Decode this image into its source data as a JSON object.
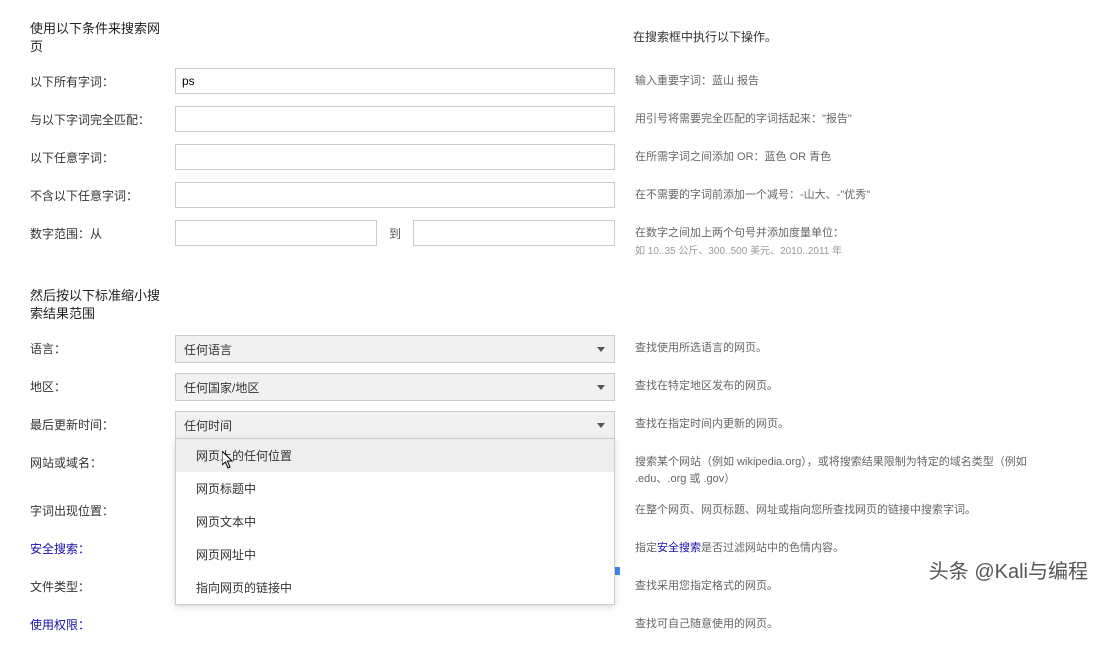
{
  "section1": {
    "title": "使用以下条件来搜索网页",
    "right_title": "在搜索框中执行以下操作。",
    "rows": [
      {
        "label": "以下所有字词：",
        "value": "ps",
        "help": "输入重要字词：蓝山 报告"
      },
      {
        "label": "与以下字词完全匹配：",
        "value": "",
        "help": "用引号将需要完全匹配的字词括起来：\"报告\""
      },
      {
        "label": "以下任意字词：",
        "value": "",
        "help": "在所需字词之间添加 OR：蓝色 OR 青色"
      },
      {
        "label": "不含以下任意字词：",
        "value": "",
        "help": "在不需要的字词前添加一个减号：-山大、-\"优秀\""
      }
    ],
    "range": {
      "label": "数字范围：从",
      "from": "",
      "sep": "到",
      "to": "",
      "help": "在数字之间加上两个句号并添加度量单位：",
      "help_sub": "如 10..35 公斤、300..500 美元、2010..2011 年"
    }
  },
  "section2": {
    "title": "然后按以下标准缩小搜索结果范围",
    "rows": [
      {
        "label": "语言：",
        "selected": "任何语言",
        "help": "查找使用所选语言的网页。"
      },
      {
        "label": "地区：",
        "selected": "任何国家/地区",
        "help": "查找在特定地区发布的网页。"
      },
      {
        "label": "最后更新时间：",
        "selected": "任何时间",
        "help": "查找在指定时间内更新的网页。"
      },
      {
        "label": "网站或域名：",
        "value": "",
        "help": "搜索某个网站（例如 wikipedia.org），或将搜索结果限制为特定的域名类型（例如 .edu、.org 或 .gov）"
      },
      {
        "label": "字词出现位置：",
        "selected": "网页上的任何位置",
        "help": "在整个网页、网页标题、网址或指向您所查找网页的链接中搜索字词。"
      },
      {
        "label": "安全搜索：",
        "link": true,
        "help_prefix": "指定",
        "help_link": "安全搜索",
        "help_suffix": "是否过滤网站中的色情内容。"
      },
      {
        "label": "文件类型：",
        "help": "查找采用您指定格式的网页。"
      },
      {
        "label": "使用权限：",
        "link": true,
        "help": "查找可自己随意使用的网页。"
      }
    ]
  },
  "dropdown": {
    "items": [
      "网页上的任何位置",
      "网页标题中",
      "网页文本中",
      "网页网址中",
      "指向网页的链接中"
    ]
  },
  "watermark": "头条 @Kali与编程"
}
